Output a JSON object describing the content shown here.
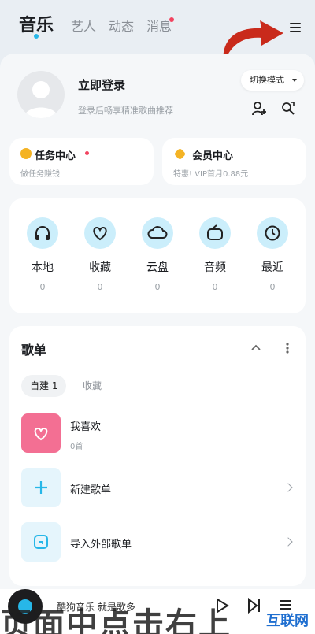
{
  "nav": {
    "tabs": [
      {
        "label": "音乐",
        "active": true
      },
      {
        "label": "艺人",
        "active": false
      },
      {
        "label": "动态",
        "active": false
      },
      {
        "label": "消息",
        "active": false,
        "badge": true
      }
    ]
  },
  "profile": {
    "title": "立即登录",
    "subtitle": "登录后畅享精准歌曲推荐",
    "switch_mode": "切换模式"
  },
  "cards": {
    "task": {
      "title": "任务中心",
      "subtitle": "做任务赚钱"
    },
    "vip": {
      "title": "会员中心",
      "subtitle": "特惠! VIP首月0.88元"
    }
  },
  "quick": [
    {
      "label": "本地",
      "count": "0",
      "icon": "headphones-icon"
    },
    {
      "label": "收藏",
      "count": "0",
      "icon": "heart-icon"
    },
    {
      "label": "云盘",
      "count": "0",
      "icon": "cloud-icon"
    },
    {
      "label": "音频",
      "count": "0",
      "icon": "radio-icon"
    },
    {
      "label": "最近",
      "count": "0",
      "icon": "clock-icon"
    }
  ],
  "playlist": {
    "title": "歌单",
    "tabs": {
      "own": "自建 1",
      "fav": "收藏"
    },
    "rows": [
      {
        "title": "我喜欢",
        "sub": "0首"
      },
      {
        "title": "新建歌单"
      },
      {
        "title": "导入外部歌单"
      }
    ]
  },
  "player": {
    "text": "酷狗音乐  就是歌多"
  },
  "overlay": {
    "text": "页面中点击右上"
  },
  "watermark": {
    "text": "互联网"
  },
  "colors": {
    "accent": "#27b7e8",
    "pink": "#f36f93",
    "light_blue": "#cbeefb",
    "red_arrow": "#c92a1b"
  }
}
